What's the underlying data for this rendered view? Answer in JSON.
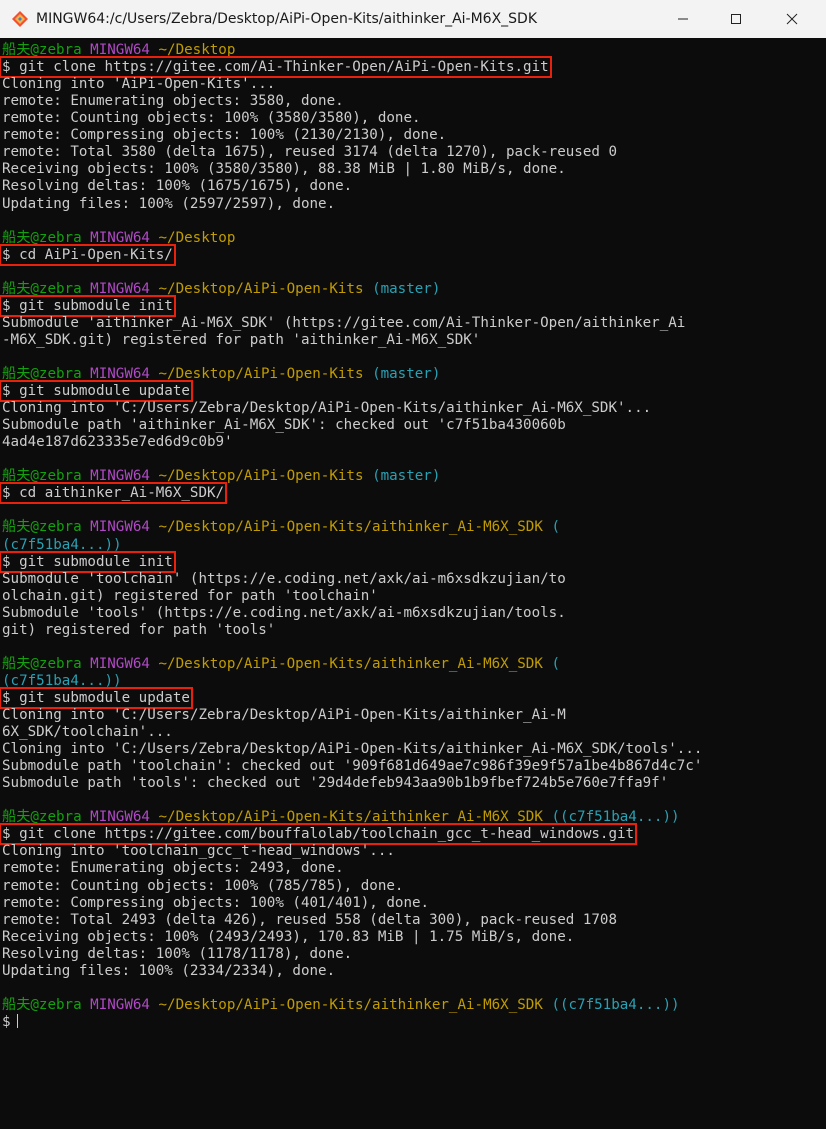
{
  "window": {
    "title": "MINGW64:/c/Users/Zebra/Desktop/AiPi-Open-Kits/aithinker_Ai-M6X_SDK",
    "icon": "git-bash-icon",
    "controls": [
      "minimize-icon",
      "maximize-icon",
      "close-icon"
    ]
  },
  "colors": {
    "background": "#0c0c0c",
    "text": "#cccccc",
    "user_host": "#13a10e",
    "msystem": "#b148c6",
    "path": "#c19c00",
    "branch": "#2aa1b3",
    "highlight_box": "#e8210c"
  },
  "terminal": {
    "lines": [
      {
        "k": "prompt",
        "user": "船夫@zebra",
        "sys": "MINGW64",
        "path": "~/Desktop",
        "branch": ""
      },
      {
        "k": "cmd",
        "text": "$ git clone https://gitee.com/Ai-Thinker-Open/AiPi-Open-Kits.git"
      },
      {
        "k": "out",
        "text": "Cloning into 'AiPi-Open-Kits'..."
      },
      {
        "k": "out",
        "text": "remote: Enumerating objects: 3580, done."
      },
      {
        "k": "out",
        "text": "remote: Counting objects: 100% (3580/3580), done."
      },
      {
        "k": "out",
        "text": "remote: Compressing objects: 100% (2130/2130), done."
      },
      {
        "k": "out",
        "text": "remote: Total 3580 (delta 1675), reused 3174 (delta 1270), pack-reused 0"
      },
      {
        "k": "out",
        "text": "Receiving objects: 100% (3580/3580), 88.38 MiB | 1.80 MiB/s, done."
      },
      {
        "k": "out",
        "text": "Resolving deltas: 100% (1675/1675), done."
      },
      {
        "k": "out",
        "text": "Updating files: 100% (2597/2597), done."
      },
      {
        "k": "blank",
        "text": ""
      },
      {
        "k": "prompt",
        "user": "船夫@zebra",
        "sys": "MINGW64",
        "path": "~/Desktop",
        "branch": ""
      },
      {
        "k": "cmd",
        "text": "$ cd AiPi-Open-Kits/"
      },
      {
        "k": "blank",
        "text": ""
      },
      {
        "k": "prompt",
        "user": "船夫@zebra",
        "sys": "MINGW64",
        "path": "~/Desktop/AiPi-Open-Kits",
        "branch": "(master)"
      },
      {
        "k": "cmd",
        "text": "$ git submodule init"
      },
      {
        "k": "out",
        "text": "Submodule 'aithinker_Ai-M6X_SDK' (https://gitee.com/Ai-Thinker-Open/aithinker_Ai"
      },
      {
        "k": "out",
        "text": "-M6X_SDK.git) registered for path 'aithinker_Ai-M6X_SDK'"
      },
      {
        "k": "blank",
        "text": ""
      },
      {
        "k": "prompt",
        "user": "船夫@zebra",
        "sys": "MINGW64",
        "path": "~/Desktop/AiPi-Open-Kits",
        "branch": "(master)"
      },
      {
        "k": "cmd",
        "text": "$ git submodule update"
      },
      {
        "k": "out",
        "text": "Cloning into 'C:/Users/Zebra/Desktop/AiPi-Open-Kits/aithinker_Ai-M6X_SDK'..."
      },
      {
        "k": "out",
        "text": "Submodule path 'aithinker_Ai-M6X_SDK': checked out 'c7f51ba430060b"
      },
      {
        "k": "out",
        "text": "4ad4e187d623335e7ed6d9c0b9'"
      },
      {
        "k": "blank",
        "text": ""
      },
      {
        "k": "prompt",
        "user": "船夫@zebra",
        "sys": "MINGW64",
        "path": "~/Desktop/AiPi-Open-Kits",
        "branch": "(master)"
      },
      {
        "k": "cmd",
        "text": "$ cd aithinker_Ai-M6X_SDK/"
      },
      {
        "k": "blank",
        "text": ""
      },
      {
        "k": "prompt",
        "user": "船夫@zebra",
        "sys": "MINGW64",
        "path": "~/Desktop/AiPi-Open-Kits/aithinker_Ai-M6X_SDK",
        "branch": "("
      },
      {
        "k": "cont",
        "text": "(c7f51ba4...))"
      },
      {
        "k": "cmd",
        "text": "$ git submodule init"
      },
      {
        "k": "out",
        "text": "Submodule 'toolchain' (https://e.coding.net/axk/ai-m6xsdkzujian/to"
      },
      {
        "k": "out",
        "text": "olchain.git) registered for path 'toolchain'"
      },
      {
        "k": "out",
        "text": "Submodule 'tools' (https://e.coding.net/axk/ai-m6xsdkzujian/tools."
      },
      {
        "k": "out",
        "text": "git) registered for path 'tools'"
      },
      {
        "k": "blank",
        "text": ""
      },
      {
        "k": "prompt",
        "user": "船夫@zebra",
        "sys": "MINGW64",
        "path": "~/Desktop/AiPi-Open-Kits/aithinker_Ai-M6X_SDK",
        "branch": "("
      },
      {
        "k": "cont",
        "text": "(c7f51ba4...))"
      },
      {
        "k": "cmd",
        "text": "$ git submodule update"
      },
      {
        "k": "out",
        "text": "Cloning into 'C:/Users/Zebra/Desktop/AiPi-Open-Kits/aithinker_Ai-M"
      },
      {
        "k": "out",
        "text": "6X_SDK/toolchain'..."
      },
      {
        "k": "out",
        "text": "Cloning into 'C:/Users/Zebra/Desktop/AiPi-Open-Kits/aithinker_Ai-M6X_SDK/tools'..."
      },
      {
        "k": "out",
        "text": "Submodule path 'toolchain': checked out '909f681d649ae7c986f39e9f57a1be4b867d4c7c'"
      },
      {
        "k": "out",
        "text": "Submodule path 'tools': checked out '29d4defeb943aa90b1b9fbef724b5e760e7ffa9f'"
      },
      {
        "k": "blank",
        "text": ""
      },
      {
        "k": "prompt",
        "user": "船夫@zebra",
        "sys": "MINGW64",
        "path": "~/Desktop/AiPi-Open-Kits/aithinker_Ai-M6X_SDK",
        "branch": "((c7f51ba4...))"
      },
      {
        "k": "cmd",
        "text": "$ git clone https://gitee.com/bouffalolab/toolchain_gcc_t-head_windows.git"
      },
      {
        "k": "out",
        "text": "Cloning into 'toolchain_gcc_t-head_windows'..."
      },
      {
        "k": "out",
        "text": "remote: Enumerating objects: 2493, done."
      },
      {
        "k": "out",
        "text": "remote: Counting objects: 100% (785/785), done."
      },
      {
        "k": "out",
        "text": "remote: Compressing objects: 100% (401/401), done."
      },
      {
        "k": "out",
        "text": "remote: Total 2493 (delta 426), reused 558 (delta 300), pack-reused 1708"
      },
      {
        "k": "out",
        "text": "Receiving objects: 100% (2493/2493), 170.83 MiB | 1.75 MiB/s, done."
      },
      {
        "k": "out",
        "text": "Resolving deltas: 100% (1178/1178), done."
      },
      {
        "k": "out",
        "text": "Updating files: 100% (2334/2334), done."
      },
      {
        "k": "blank",
        "text": ""
      },
      {
        "k": "prompt",
        "user": "船夫@zebra",
        "sys": "MINGW64",
        "path": "~/Desktop/AiPi-Open-Kits/aithinker_Ai-M6X_SDK",
        "branch": "((c7f51ba4...))"
      },
      {
        "k": "input",
        "text": "$"
      }
    ]
  }
}
